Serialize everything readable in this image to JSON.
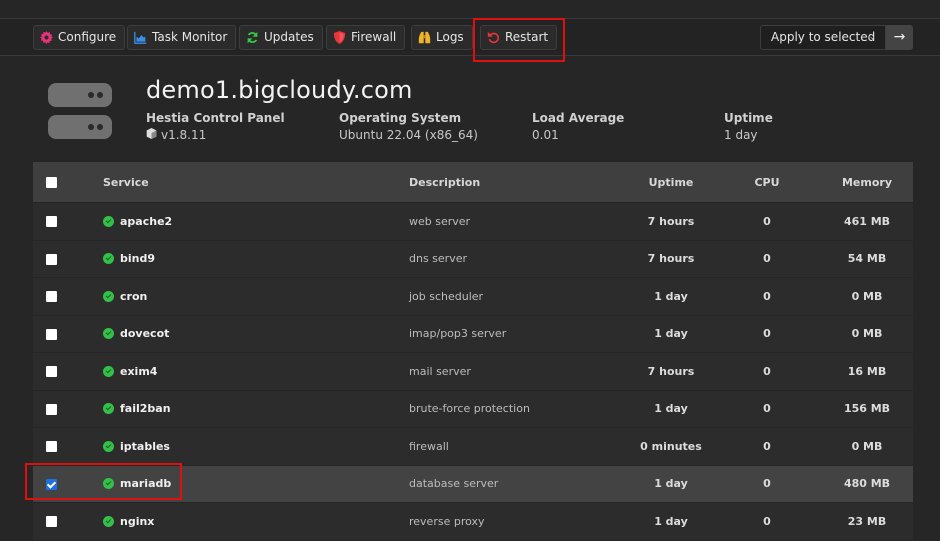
{
  "toolbar": {
    "buttons": [
      {
        "label": "Configure",
        "icon": "gear-icon",
        "color": "#e8317a"
      },
      {
        "label": "Task Monitor",
        "icon": "chart-area-icon",
        "color": "#3b8ee8"
      },
      {
        "label": "Updates",
        "icon": "refresh-icon",
        "color": "#35c64a"
      },
      {
        "label": "Firewall",
        "icon": "shield-icon",
        "color": "#e8343a"
      },
      {
        "label": "Logs",
        "icon": "binoculars-icon",
        "color": "#f0b429"
      },
      {
        "label": "Restart",
        "icon": "undo-icon",
        "color": "#e8343a"
      }
    ],
    "bulk_action": {
      "selected": "Apply to selected",
      "submit_icon": "arrow-right-icon"
    }
  },
  "server": {
    "hostname": "demo1.bigcloudy.com",
    "panel_label": "Hestia Control Panel",
    "panel_version": "v1.8.11",
    "os_label": "Operating System",
    "os_value": "Ubuntu 22.04 (x86_64)",
    "load_label": "Load Average",
    "load_value": "0.01",
    "uptime_label": "Uptime",
    "uptime_value": "1 day"
  },
  "table": {
    "headers": {
      "service": "Service",
      "description": "Description",
      "uptime": "Uptime",
      "cpu": "CPU",
      "memory": "Memory"
    },
    "rows": [
      {
        "name": "apache2",
        "description": "web server",
        "uptime": "7 hours",
        "cpu": "0",
        "memory": "461 MB",
        "checked": false
      },
      {
        "name": "bind9",
        "description": "dns server",
        "uptime": "7 hours",
        "cpu": "0",
        "memory": "54 MB",
        "checked": false
      },
      {
        "name": "cron",
        "description": "job scheduler",
        "uptime": "1 day",
        "cpu": "0",
        "memory": "0 MB",
        "checked": false
      },
      {
        "name": "dovecot",
        "description": "imap/pop3 server",
        "uptime": "1 day",
        "cpu": "0",
        "memory": "0 MB",
        "checked": false
      },
      {
        "name": "exim4",
        "description": "mail server",
        "uptime": "7 hours",
        "cpu": "0",
        "memory": "16 MB",
        "checked": false
      },
      {
        "name": "fail2ban",
        "description": "brute-force protection",
        "uptime": "1 day",
        "cpu": "0",
        "memory": "156 MB",
        "checked": false
      },
      {
        "name": "iptables",
        "description": "firewall",
        "uptime": "0 minutes",
        "cpu": "0",
        "memory": "0 MB",
        "checked": false
      },
      {
        "name": "mariadb",
        "description": "database server",
        "uptime": "1 day",
        "cpu": "0",
        "memory": "480 MB",
        "checked": true
      },
      {
        "name": "nginx",
        "description": "reverse proxy",
        "uptime": "1 day",
        "cpu": "0",
        "memory": "23 MB",
        "checked": false
      }
    ]
  }
}
